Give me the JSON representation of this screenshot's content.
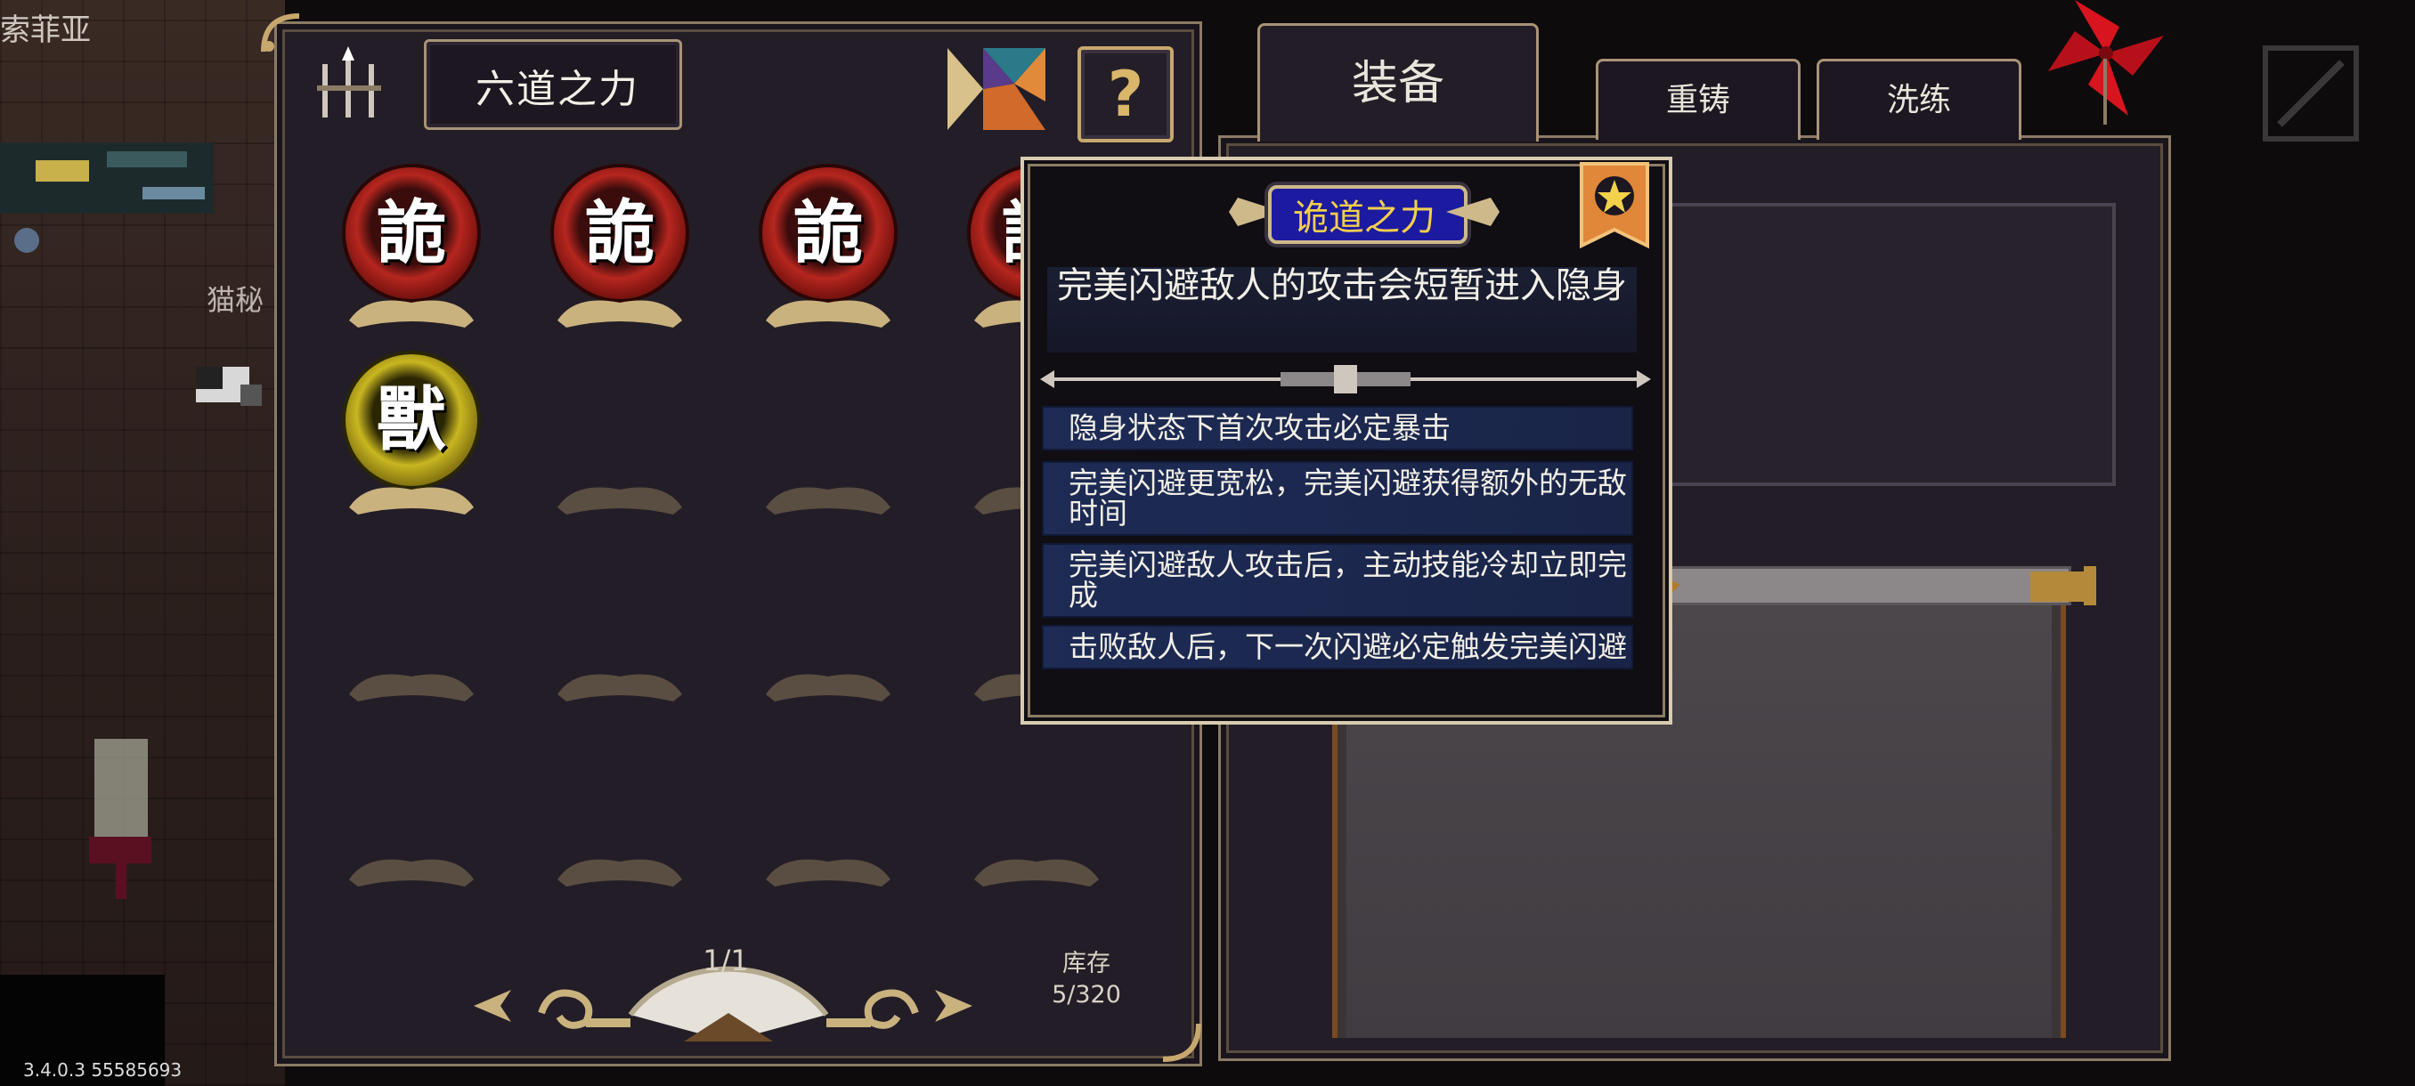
{
  "scene": {
    "player_name": "索菲亚",
    "npc_name": "猫秘",
    "version": "3.4.0.3 55585693"
  },
  "panel": {
    "title": "六道之力",
    "help_label": "?"
  },
  "orbs": [
    {
      "char": "詭",
      "color": "red"
    },
    {
      "char": "詭",
      "color": "red"
    },
    {
      "char": "詭",
      "color": "red"
    },
    {
      "char": "詭",
      "color": "red"
    },
    {
      "char": "獸",
      "color": "gold"
    }
  ],
  "pager": {
    "page": "1/1"
  },
  "storage": {
    "label": "库存",
    "value": "5/320"
  },
  "tabs": {
    "equip": "装备",
    "reforge": "重铸",
    "refine": "洗练"
  },
  "tooltip": {
    "title": "诡道之力",
    "description": "完美闪避敌人的攻击会短暂进入隐身",
    "effects": [
      "隐身状态下首次攻击必定暴击",
      "完美闪避更宽松，完美闪避获得额外的无敌时间",
      "完美闪避敌人攻击后，主动技能冷却立即完成",
      "击败敌人后，下一次闪避必定触发完美闪避"
    ]
  },
  "colors": {
    "orb_red": "#b6261f",
    "orb_gold": "#c9b621",
    "tooltip_title": "#f2cf4d",
    "frame_gold": "#a99376"
  }
}
